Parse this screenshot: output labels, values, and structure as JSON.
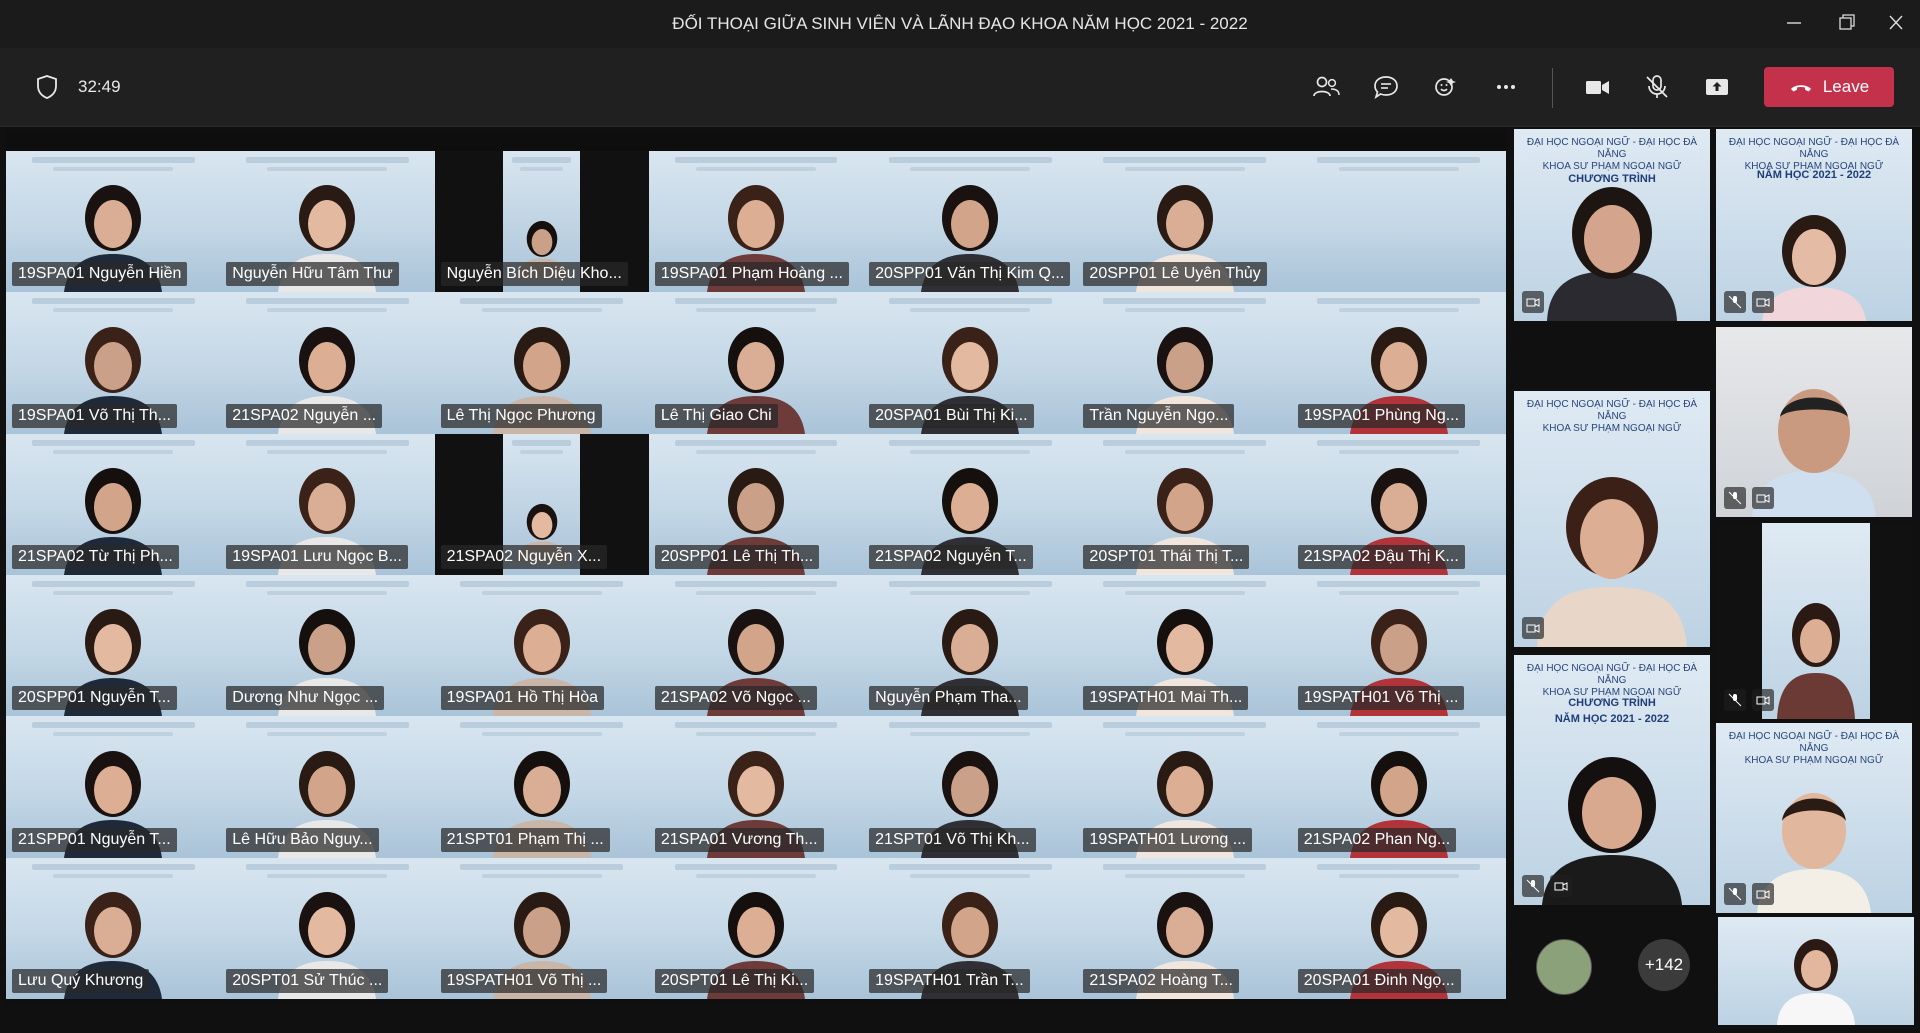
{
  "window": {
    "title": "ĐỐI THOẠI GIỮA SINH VIÊN VÀ LÃNH ĐẠO KHOA NĂM HỌC 2021 - 2022"
  },
  "toolbar": {
    "timer": "32:49",
    "leave_label": "Leave"
  },
  "main_grid": {
    "participants": [
      "19SPA01 Nguyễn Hiền",
      "Nguyễn Hữu Tâm Thư",
      "Nguyễn Bích Diệu Kho...",
      "19SPA01 Phạm Hoàng ...",
      "20SPP01 Văn Thị Kim Q...",
      "20SPP01 Lê Uyên Thủy",
      "",
      "19SPA01 Võ Thị Th...",
      "21SPA02 Nguyễn ...",
      "Lê Thị Ngọc Phương",
      "Lê Thị Giao Chi",
      "20SPA01 Bùi Thị Ki...",
      "Trần Nguyễn Ngọ...",
      "19SPA01 Phùng Ng...",
      "21SPA02 Từ Thị Ph...",
      "19SPA01 Lưu Ngọc B...",
      "21SPA02 Nguyễn X...",
      "20SPP01 Lê Thị Th...",
      "21SPA02 Nguyễn T...",
      "20SPT01 Thái Thị T...",
      "21SPA02 Đậu Thị K...",
      "20SPP01 Nguyễn T...",
      "Dương Như Ngọc ...",
      "19SPA01 Hồ Thị Hòa",
      "21SPA02 Võ Ngọc ...",
      "Nguyễn Phạm Tha...",
      "19SPATH01 Mai Th...",
      "19SPATH01 Võ Thị ...",
      "21SPP01 Nguyễn T...",
      "Lê Hữu Bảo Nguy...",
      "21SPT01 Phạm Thị ...",
      "21SPA01 Vương Th...",
      "21SPT01 Võ Thị Kh...",
      "19SPATH01 Lương ...",
      "21SPA02 Phan Ng...",
      "Lưu Quý Khương",
      "20SPT01 Sử Thúc ...",
      "19SPATH01 Võ Thị ...",
      "20SPT01 Lê Thị Ki...",
      "19SPATH01 Trần T...",
      "21SPA02 Hoàng T...",
      "20SPA01 Đinh Ngọ..."
    ]
  },
  "side_panel": {
    "banner_line1": "ĐẠI HỌC NGOẠI NGỮ - ĐẠI HỌC ĐÀ NẴNG",
    "banner_line2": "KHOA SƯ PHẠM NGOẠI NGỮ",
    "banner_program": "CHƯƠNG TRÌNH",
    "banner_title_a": "ĐỐI THOẠI GIỮA SINH VIÊN VÀ LÃNH ĐẠO",
    "banner_year": "NĂM HỌC 2021 - 2022",
    "overflow_count": "+142"
  },
  "colors": {
    "leave": "#c4314b",
    "background": "#1f1f1f"
  }
}
